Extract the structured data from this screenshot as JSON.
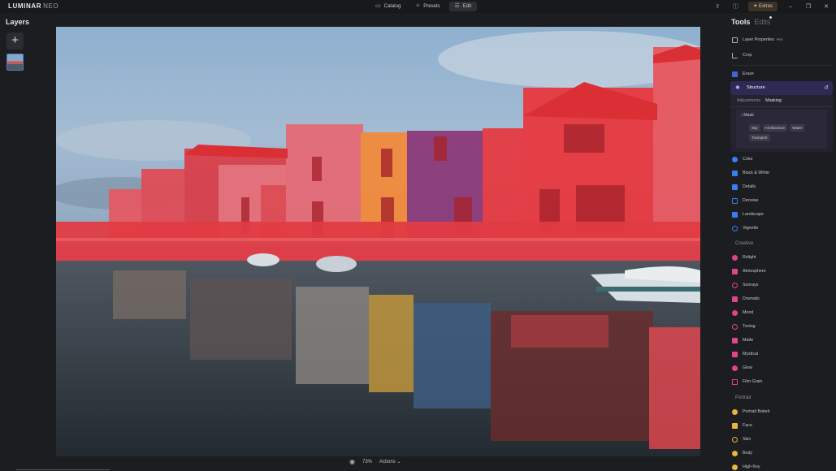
{
  "app": {
    "logo_main": "LUMINAR",
    "logo_sub": "NEO"
  },
  "nav": {
    "tabs": [
      {
        "label": "Catalog",
        "icon": "folder-icon"
      },
      {
        "label": "Presets",
        "icon": "presets-icon"
      },
      {
        "label": "Edit",
        "icon": "sliders-icon",
        "active": true
      }
    ]
  },
  "topright": {
    "extras_label": "Extras"
  },
  "layers": {
    "title": "Layers",
    "add_symbol": "+"
  },
  "canvas": {
    "zoom": "73%",
    "actions_label": "Actions"
  },
  "panel": {
    "tools_tab": "Tools",
    "edits_tab": "Edits",
    "layer_properties": "Layer Properties",
    "layer_properties_badge": "PRO",
    "crop": "Crop",
    "erase": "Erase",
    "structure": {
      "label": "Structure",
      "sub_tabs": [
        "Adjustments",
        "Masking"
      ],
      "mask_label": "Mask",
      "chips": [
        "Sky",
        "Architecture",
        "Water",
        "Transport"
      ]
    },
    "essentials": [
      "Color",
      "Black & White",
      "Details",
      "Denoise",
      "Landscape",
      "Vignette"
    ],
    "creative_label": "Creative",
    "creative": [
      "Relight",
      "Atmosphere",
      "Sunrays",
      "Dramatic",
      "Mood",
      "Toning",
      "Matte",
      "Mystical",
      "Glow",
      "Film Grain"
    ],
    "portrait_label": "Portrait",
    "portrait": [
      "Portrait Bokeh",
      "Face",
      "Skin",
      "Body",
      "High Key"
    ],
    "colors": {
      "accent": "#2f2a55",
      "mask_overlay": "#ff2a2a"
    }
  }
}
